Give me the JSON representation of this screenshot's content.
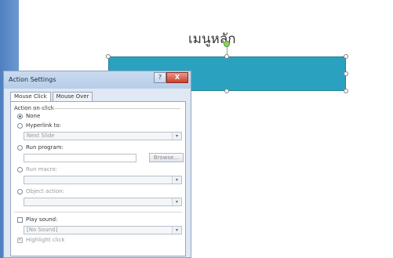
{
  "slide": {
    "title": "เมนูหลัก"
  },
  "dialog": {
    "title": "Action Settings",
    "window_buttons": {
      "minimize": "?",
      "close": "X"
    },
    "tabs": [
      {
        "label": "Mouse Click",
        "active": true
      },
      {
        "label": "Mouse Over",
        "active": false
      }
    ],
    "action_group_label": "Action on click",
    "options": {
      "none": "None",
      "hyperlink": "Hyperlink to:",
      "hyperlink_value": "Next Slide",
      "run_program": "Run program:",
      "browse": "Browse...",
      "run_macro": "Run macro:",
      "object_action": "Object action:"
    },
    "sound": {
      "play_sound": "Play sound:",
      "sound_value": "[No Sound]",
      "highlight_click": "Highlight click"
    }
  },
  "colors": {
    "shape_fill": "#2aa2bf",
    "dialog_bg": "#dfe8f3",
    "left_strip": "#5a88c8"
  }
}
